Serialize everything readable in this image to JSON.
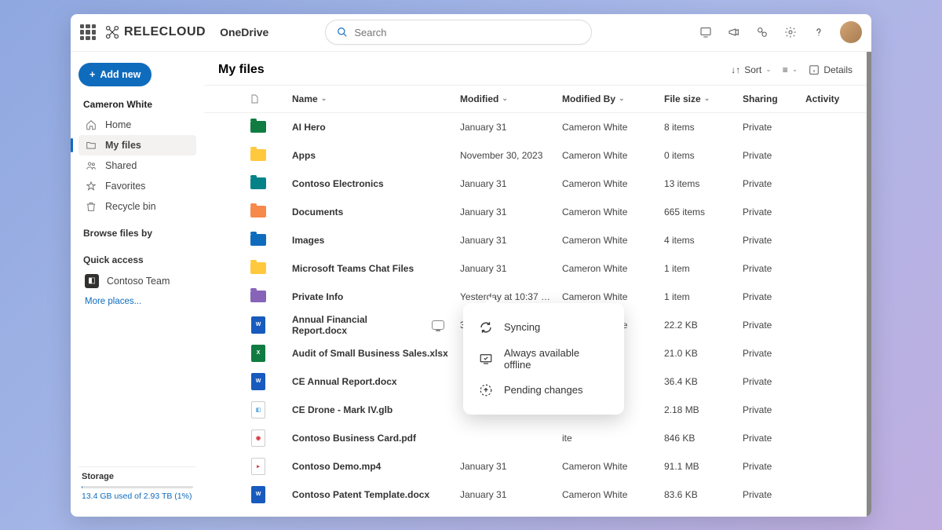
{
  "header": {
    "brand": "RELECLOUD",
    "app": "OneDrive",
    "search_placeholder": "Search"
  },
  "sidebar": {
    "add_new": "Add new",
    "user": "Cameron White",
    "nav": [
      {
        "label": "Home",
        "icon": "home"
      },
      {
        "label": "My files",
        "icon": "folder",
        "active": true
      },
      {
        "label": "Shared",
        "icon": "people"
      },
      {
        "label": "Favorites",
        "icon": "star"
      },
      {
        "label": "Recycle bin",
        "icon": "trash"
      }
    ],
    "browse_label": "Browse files by",
    "quick_label": "Quick access",
    "quick_items": [
      {
        "label": "Contoso Team"
      }
    ],
    "more_places": "More places...",
    "storage_label": "Storage",
    "storage_text": "13.4 GB used of 2.93 TB (1%)"
  },
  "main": {
    "title": "My files",
    "sort": "Sort",
    "details": "Details",
    "columns": {
      "name": "Name",
      "modified": "Modified",
      "modified_by": "Modified By",
      "size": "File size",
      "sharing": "Sharing",
      "activity": "Activity"
    },
    "rows": [
      {
        "type": "folder",
        "color": "#107c41",
        "name": "AI Hero",
        "modified": "January 31",
        "by": "Cameron White",
        "size": "8 items",
        "sharing": "Private"
      },
      {
        "type": "folder",
        "color": "#ffc83d",
        "name": "Apps",
        "modified": "November 30, 2023",
        "by": "Cameron White",
        "size": "0 items",
        "sharing": "Private"
      },
      {
        "type": "folder",
        "color": "#038387",
        "name": "Contoso Electronics",
        "modified": "January 31",
        "by": "Cameron White",
        "size": "13 items",
        "sharing": "Private"
      },
      {
        "type": "folder",
        "color": "#f7894a",
        "name": "Documents",
        "modified": "January 31",
        "by": "Cameron White",
        "size": "665 items",
        "sharing": "Private"
      },
      {
        "type": "folder",
        "color": "#0f6cbd",
        "name": "Images",
        "modified": "January 31",
        "by": "Cameron White",
        "size": "4 items",
        "sharing": "Private"
      },
      {
        "type": "folder",
        "color": "#ffc83d",
        "name": "Microsoft Teams Chat Files",
        "modified": "January 31",
        "by": "Cameron White",
        "size": "1 item",
        "sharing": "Private"
      },
      {
        "type": "folder",
        "color": "#8764b8",
        "name": "Private Info",
        "modified": "Yesterday at 10:37 …",
        "by": "Cameron White",
        "size": "1 item",
        "sharing": "Private"
      },
      {
        "type": "docx",
        "name": "Annual Financial Report.docx",
        "modified": "3 minutes ago",
        "by": "Cameron White",
        "size": "22.2 KB",
        "sharing": "Private",
        "sync": true
      },
      {
        "type": "xlsx",
        "name": "Audit of Small Business Sales.xlsx",
        "modified": "",
        "by": "White",
        "size": "21.0 KB",
        "sharing": "Private"
      },
      {
        "type": "docx",
        "name": "CE Annual Report.docx",
        "modified": "",
        "by": "ite",
        "size": "36.4 KB",
        "sharing": "Private"
      },
      {
        "type": "glb",
        "name": "CE Drone - Mark IV.glb",
        "modified": "",
        "by": "ite",
        "size": "2.18 MB",
        "sharing": "Private"
      },
      {
        "type": "pdf",
        "name": "Contoso Business Card.pdf",
        "modified": "",
        "by": "ite",
        "size": "846 KB",
        "sharing": "Private"
      },
      {
        "type": "mp4",
        "name": "Contoso Demo.mp4",
        "modified": "January 31",
        "by": "Cameron White",
        "size": "91.1 MB",
        "sharing": "Private"
      },
      {
        "type": "docx",
        "name": "Contoso Patent Template.docx",
        "modified": "January 31",
        "by": "Cameron White",
        "size": "83.6 KB",
        "sharing": "Private"
      }
    ]
  },
  "popup": {
    "syncing": "Syncing",
    "offline": "Always available offline",
    "pending": "Pending changes"
  }
}
